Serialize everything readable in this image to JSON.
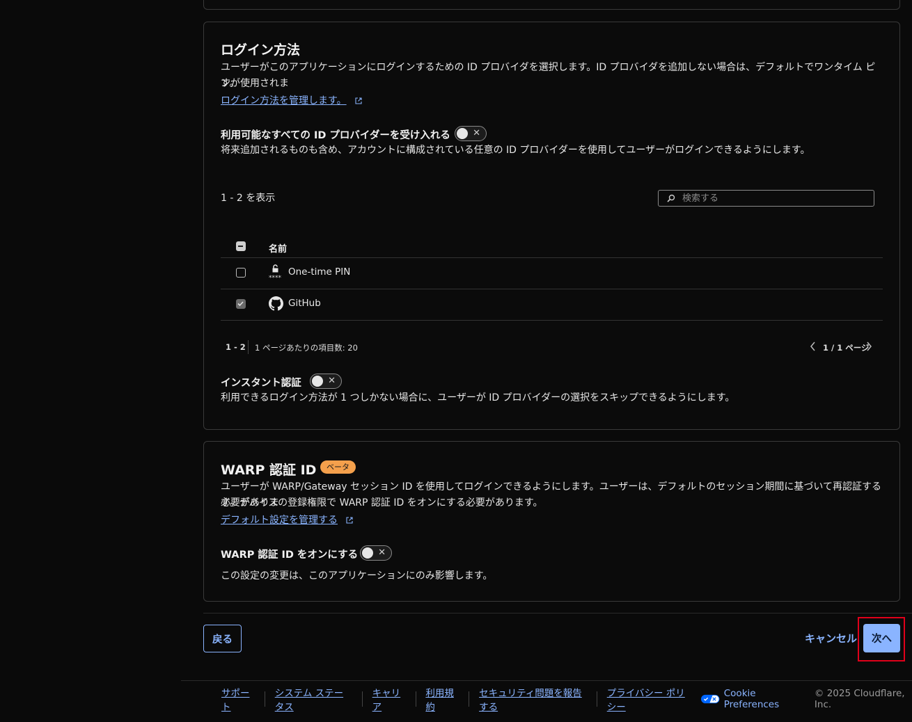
{
  "login": {
    "title": "ログイン方法",
    "desc_line1": "ユーザーがこのアプリケーションにログインするための ID プロバイダを選択します。ID プロバイダを追加しない場合は、デフォルトでワンタイム ピンが使用されま",
    "desc_line2": "す。",
    "manage_link": "ログイン方法を管理します。",
    "accept_all_label": "利用可能なすべての ID プロバイダーを受け入れる",
    "accept_all_desc": "将来追加されるものも含め、アカウントに構成されている任意の ID プロバイダーを使用してユーザーがログインできるようにします。",
    "showing": "1 - 2 を表示",
    "search_placeholder": "検索する",
    "column_name": "名前",
    "rows": [
      {
        "name": "One-time PIN",
        "checked": false,
        "icon": "lock-icon",
        "icon_sub": "****"
      },
      {
        "name": "GitHub",
        "checked": true,
        "icon": "github-icon"
      }
    ],
    "pager_range": "1 - 2",
    "pager_per_page": "1 ページあたりの項目数: 20",
    "pager_page": "1 / 1 ページ",
    "instant_label": "インスタント認証",
    "instant_desc": "利用できるログイン方法が 1 つしかない場合に、ユーザーが ID プロバイダーの選択をスキップできるようにします。"
  },
  "warp": {
    "title": "WARP 認証 ID",
    "badge": "ベータ",
    "desc_line1": "ユーザーが WARP/Gateway セッション ID を使用してログインできるようにします。ユーザーは、デフォルトのセッション期間に基づいて再認証する必要がありま",
    "desc_line2": "す。デバイスの登録権限で WARP 認証 ID をオンにする必要があります。",
    "manage_link": "デフォルト設定を管理する",
    "toggle_label": "WARP 認証 ID をオンにする",
    "toggle_desc": "この設定の変更は、このアプリケーションにのみ影響します。"
  },
  "actions": {
    "back": "戻る",
    "cancel": "キャンセル",
    "next": "次へ"
  },
  "footer": {
    "links": [
      "サポート",
      "システム ステータス",
      "キャリア",
      "利用規約",
      "セキュリティ問題を報告する",
      "プライバシー ポリシー"
    ],
    "cookie": "Cookie Preferences",
    "copyright": "© 2025 Cloudflare, Inc."
  },
  "colors": {
    "background": "#0a0a0a",
    "link": "#8ab4ff",
    "primary_button": "#8ab4ff",
    "badge": "#f4a04c",
    "highlight": "#e0001a"
  }
}
